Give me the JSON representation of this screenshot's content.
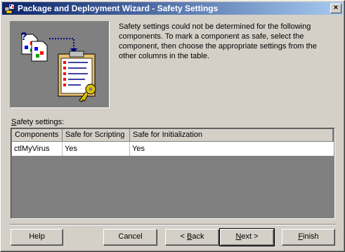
{
  "window": {
    "title": "Package and Deployment Wizard - Safety Settings",
    "close_glyph": "×"
  },
  "description": "Safety settings could not be determined for the following components. To mark a component as safe, select the component, then choose the appropriate settings from the other columns in the table.",
  "safety_label": {
    "mnemonic": "S",
    "rest": "afety settings:"
  },
  "grid": {
    "columns": [
      "Components",
      "Safe for Scripting",
      "Safe for Initialization"
    ],
    "rows": [
      [
        "ctlMyVirus",
        "Yes",
        "Yes"
      ]
    ]
  },
  "buttons": {
    "help": "Help",
    "cancel": "Cancel",
    "back_prefix": "< ",
    "back_mnemonic": "B",
    "back_rest": "ack",
    "next_mnemonic": "N",
    "next_rest": "ext >",
    "finish_mnemonic": "F",
    "finish_rest": "inish"
  },
  "icons": {
    "app": "wizard-app-icon",
    "illustration": "components-checklist-key-illustration"
  }
}
